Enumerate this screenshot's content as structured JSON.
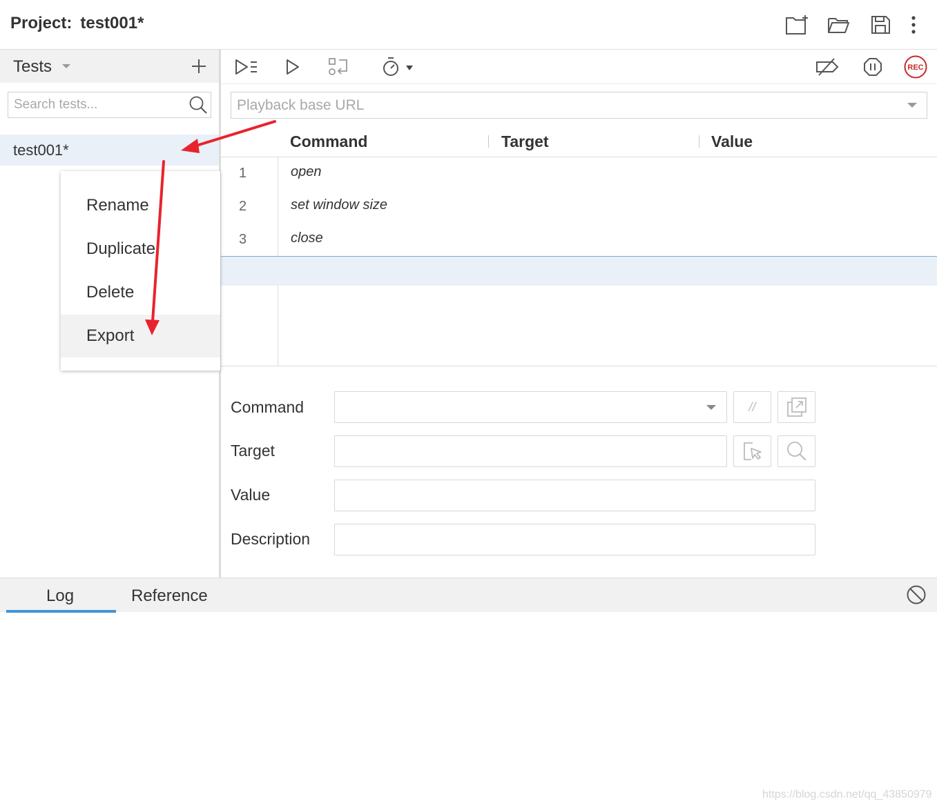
{
  "header": {
    "project_label": "Project:",
    "project_name": "test001*",
    "icons": [
      "new-project-icon",
      "open-project-icon",
      "save-project-icon",
      "more-options-icon"
    ]
  },
  "tests_panel": {
    "title": "Tests",
    "search_placeholder": "Search tests...",
    "items": [
      {
        "label": "test001*",
        "selected": true
      }
    ]
  },
  "context_menu": {
    "items": [
      {
        "label": "Rename"
      },
      {
        "label": "Duplicate"
      },
      {
        "label": "Delete"
      },
      {
        "label": "Export",
        "hovered": true
      }
    ]
  },
  "toolbar": {
    "icons": [
      "run-all-tests-icon",
      "run-current-test-icon",
      "step-over-icon",
      "speed-icon",
      "disable-breakpoints-icon",
      "pause-on-exceptions-icon",
      "record-button"
    ],
    "record_label": "REC",
    "record_color": "#c62828"
  },
  "url_bar": {
    "placeholder": "Playback base URL"
  },
  "table": {
    "headers": [
      "Command",
      "Target",
      "Value"
    ],
    "rows": [
      {
        "num": "1",
        "command": "open",
        "target": "",
        "value": ""
      },
      {
        "num": "2",
        "command": "set window size",
        "target": "",
        "value": ""
      },
      {
        "num": "3",
        "command": "close",
        "target": "",
        "value": ""
      }
    ]
  },
  "editor": {
    "command_label": "Command",
    "target_label": "Target",
    "value_label": "Value",
    "description_label": "Description",
    "comment_toggle_label": "//"
  },
  "bottom_tabs": {
    "log": "Log",
    "reference": "Reference"
  },
  "watermark": "https://blog.csdn.net/qq_43850979",
  "colors": {
    "selection": "#e9f0f8",
    "accent": "#3f95d8",
    "annotation_arrow": "#e8232d"
  }
}
